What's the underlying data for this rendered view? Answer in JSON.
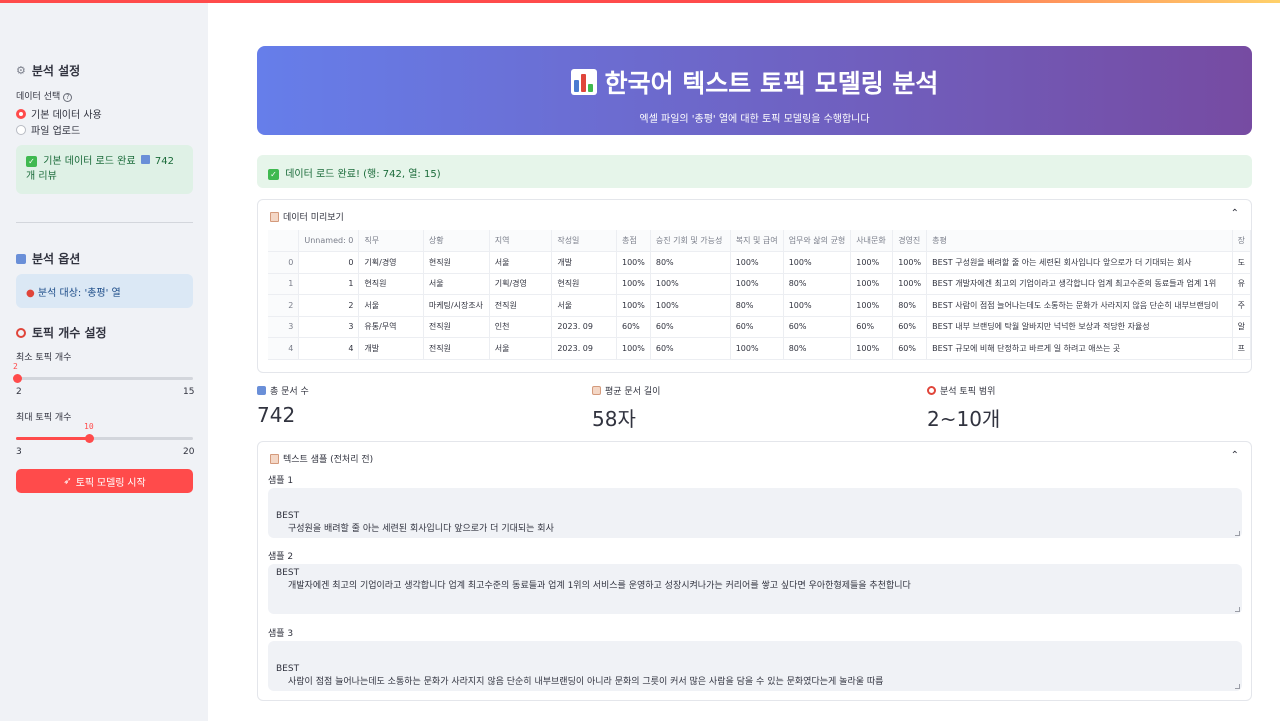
{
  "sidebar": {
    "analysis_settings_title": "분석 설정",
    "data_select_label": "데이터 선택",
    "radio_options": [
      "기본 데이터 사용",
      "파일 업로드"
    ],
    "selected_option": "기본 데이터 사용",
    "load_success_text": "기본 데이터 로드 완료",
    "review_count_text": "742개 리뷰",
    "analysis_options_title": "분석 옵션",
    "analysis_target_text": "분석 대상: '총평' 열",
    "topic_count_title": "토픽 개수 설정",
    "min_slider": {
      "label": "최소 토픽 개수",
      "value": "2",
      "min": "2",
      "max": "15"
    },
    "max_slider": {
      "label": "최대 토픽 개수",
      "value": "10",
      "min": "3",
      "max": "20"
    },
    "start_button": "토픽 모델링 시작"
  },
  "banner": {
    "title": "한국어 텍스트 토픽 모델링 분석",
    "subtitle": "엑셀 파일의 '총평' 열에 대한 토픽 모델링을 수행합니다"
  },
  "load_message": "데이터 로드 완료! (행: 742, 열: 15)",
  "preview": {
    "title": "데이터 미리보기",
    "columns": [
      "",
      "Unnamed: 0",
      "직무",
      "상황",
      "지역",
      "작성일",
      "총점",
      "승진 기회 및 가능성",
      "복지 및 급여",
      "업무와 삶의 균형",
      "사내문화",
      "경영진",
      "총평",
      "장"
    ],
    "rows": [
      [
        "0",
        "0",
        "기획/경영",
        "현직원",
        "서울",
        "개발",
        "100%",
        "80%",
        "100%",
        "100%",
        "100%",
        "100%",
        "BEST  구성원을 배려할 줄 아는 세련된 회사입니다 앞으로가 더 기대되는 회사",
        "도"
      ],
      [
        "1",
        "1",
        "현직원",
        "서울",
        "기획/경영",
        "현직원",
        "100%",
        "100%",
        "100%",
        "80%",
        "100%",
        "100%",
        "BEST  개발자에겐 최고의 기업이라고 생각합니다 업계 최고수준의 동료들과 업계 1위",
        "유"
      ],
      [
        "2",
        "2",
        "서울",
        "마케팅/시장조사",
        "전직원",
        "서울",
        "100%",
        "100%",
        "80%",
        "100%",
        "100%",
        "80%",
        "BEST  사람이 점점 늘어나는데도 소통하는 문화가 사라지지 않음 단순히 내부브랜딩이",
        "주"
      ],
      [
        "3",
        "3",
        "유통/무역",
        "전직원",
        "인천",
        "2023. 09",
        "60%",
        "60%",
        "60%",
        "60%",
        "60%",
        "60%",
        "BEST  내부 브랜딩에 탁월 알바지만 넉넉한 보상과 적당한 자율성",
        "알"
      ],
      [
        "4",
        "4",
        "개발",
        "전직원",
        "서울",
        "2023. 09",
        "100%",
        "60%",
        "100%",
        "80%",
        "100%",
        "60%",
        "BEST  규모에 비해 단정하고 바르게 일 하려고 애쓰는 곳",
        "프"
      ]
    ]
  },
  "metrics": [
    {
      "label": "총 문서 수",
      "value": "742"
    },
    {
      "label": "평균 문서 길이",
      "value": "58자"
    },
    {
      "label": "분석 토픽 범위",
      "value": "2~10개"
    }
  ],
  "samples_section": {
    "title": "텍스트 샘플 (전처리 전)",
    "samples": [
      {
        "label": "샘플 1",
        "line1": "BEST",
        "line2": "구성원을 배려할 줄 아는 세련된 회사입니다 앞으로가 더 기대되는 회사"
      },
      {
        "label": "샘플 2",
        "line1": "BEST",
        "line2": "개발자에겐 최고의 기업이라고 생각합니다 업계 최고수준의 동료들과 업계 1위의 서비스를 운영하고 성장시켜나가는 커리어를 쌓고 싶다면 우아한형제들을 추천합니다"
      },
      {
        "label": "샘플 3",
        "line1": "BEST",
        "line2": "사람이 점점 늘어나는데도 소통하는 문화가 사라지지 않음 단순히 내부브랜딩이 아니라 문화의 그릇이 커서 많은 사람을 담을 수 있는 문화였다는게 놀라울 따름"
      }
    ]
  },
  "colors": {
    "accent": "#ff4b4b",
    "banner_start": "#667eea",
    "banner_end": "#764ba2",
    "success_bg": "#dff1e6",
    "info_bg": "#dbe8f5",
    "sidebar_bg": "#f0f2f6"
  }
}
